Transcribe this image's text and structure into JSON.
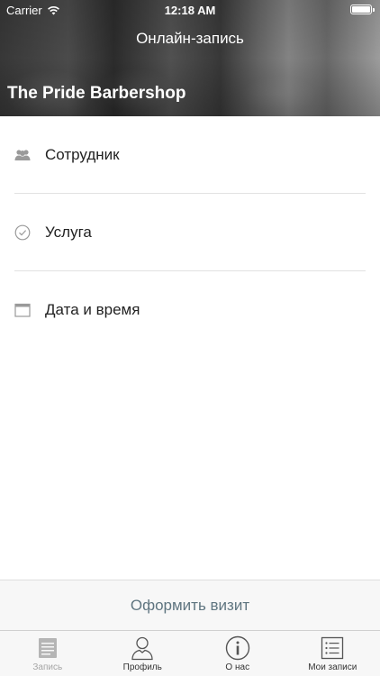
{
  "status_bar": {
    "carrier": "Carrier",
    "time": "12:18 AM"
  },
  "header": {
    "title": "Онлайн-запись",
    "shop_name": "The Pride Barbershop"
  },
  "rows": [
    {
      "label": "Сотрудник",
      "icon": "group-icon"
    },
    {
      "label": "Услуга",
      "icon": "check-circle-icon"
    },
    {
      "label": "Дата и время",
      "icon": "calendar-icon"
    }
  ],
  "book_button": {
    "label": "Оформить визит"
  },
  "tabs": [
    {
      "label": "Запись",
      "icon": "document-icon",
      "active": false
    },
    {
      "label": "Профиль",
      "icon": "person-icon",
      "active": true
    },
    {
      "label": "О нас",
      "icon": "info-icon",
      "active": true
    },
    {
      "label": "Мои записи",
      "icon": "list-icon",
      "active": true
    }
  ],
  "colors": {
    "accent_text": "#5f7580",
    "icon_gray": "#9a9a9a"
  }
}
